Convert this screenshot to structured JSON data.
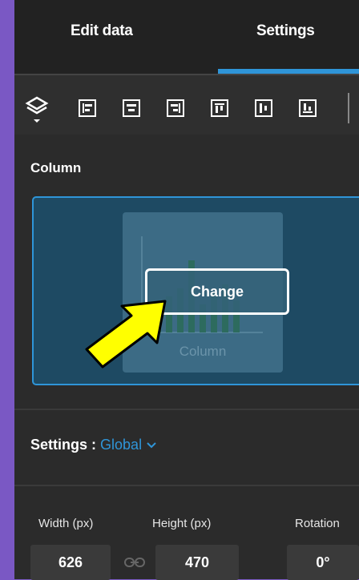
{
  "tabs": [
    {
      "label": "Edit data"
    },
    {
      "label": "Settings"
    }
  ],
  "active_tab": "Settings",
  "toolbar": {
    "icons": [
      "layers-icon",
      "align-left-icon",
      "align-center-icon",
      "align-right-icon",
      "align-top-icon",
      "align-middle-icon",
      "align-bottom-icon"
    ]
  },
  "chart_type": {
    "section_label": "Column",
    "thumbnail_caption": "Column",
    "change_button": "Change"
  },
  "settings_scope": {
    "label": "Settings :",
    "value": "Global"
  },
  "fields": {
    "width_label": "Width (px)",
    "width_value": "626",
    "height_label": "Height (px)",
    "height_value": "470",
    "rotation_label": "Rotation",
    "rotation_value": "0°"
  },
  "colors": {
    "accent": "#2f95d8",
    "annotation_arrow": "#ffff00"
  }
}
